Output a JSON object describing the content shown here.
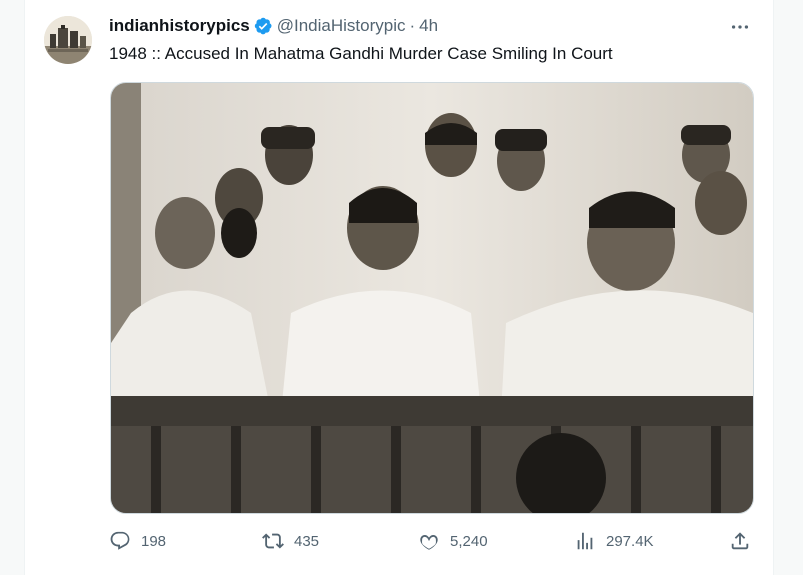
{
  "author": {
    "display_name": "indianhistorypics",
    "handle": "@IndiaHistorypic",
    "separator": "·",
    "time": "4h"
  },
  "tweet": {
    "text": "1948 ::  Accused In Mahatma Gandhi Murder Case Smiling In Court"
  },
  "icons": {
    "verified": "verified-badge-icon",
    "more": "more-horizontal-icon",
    "reply": "reply-icon",
    "retweet": "retweet-icon",
    "like": "like-icon",
    "views": "views-icon",
    "share": "share-icon"
  },
  "actions": {
    "replies": "198",
    "retweets": "435",
    "likes": "5,240",
    "views": "297.4K"
  },
  "colors": {
    "verified": "#1d9bf0",
    "secondary_text": "#536471",
    "border": "#cfd9de"
  }
}
